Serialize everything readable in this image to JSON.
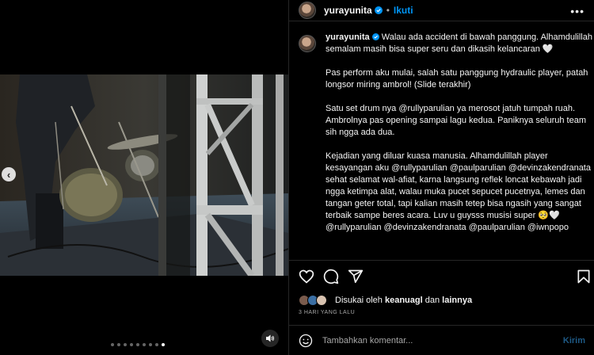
{
  "post": {
    "username": "yurayunita",
    "follow_label": "Ikuti",
    "separator": "•",
    "more_icon": "more-horizontal-icon",
    "caption": {
      "username": "yurayunita",
      "para1": "Walau ada accident di bawah panggung. Alhamdulillah semalam masih bisa super seru dan dikasih kelancaran 🤍",
      "para2": "Pas perform aku mulai, salah satu panggung hydraulic player, patah longsor miring ambrol! (Slide terakhir)",
      "para3": "Satu set drum nya @rullyparulian ya merosot jatuh tumpah ruah. Ambrolnya pas opening sampai lagu kedua. Paniknya seluruh team sih ngga ada dua.",
      "para4_line1": "Kejadian yang diluar kuasa manusia. Alhamdulillah player kesayangan aku @rullyparulian @paulparulian @devinzakendranata",
      "para4_line2": "sehat selamat wal-afiat, karna langsung reflek loncat kebawah jadi ngga ketimpa alat, walau muka pucet sepucet pucetnya, lemes dan tangan geter total, tapi kalian masih tetep bisa ngasih yang sangat terbaik sampe beres acara. Luv u guysss musisi super 🥺🤍",
      "para5": "@rullyparulian @devinzakendranata @paulparulian @iwnpopo"
    },
    "likes": {
      "prefix": "Disukai oleh",
      "user": "keanuagl",
      "conj": "dan",
      "others": "lainnya"
    },
    "timestamp": "3 HARI YANG LALU",
    "comment": {
      "placeholder": "Tambahkan komentar...",
      "post_label": "Kirim"
    }
  },
  "carousel": {
    "slide_count": 9,
    "active_index": 8,
    "prev_glyph": "‹"
  },
  "colors": {
    "background": "#000000",
    "text": "#f5f5f5",
    "secondary": "#a8a8a8",
    "accent": "#0095f6",
    "border": "#262626"
  }
}
